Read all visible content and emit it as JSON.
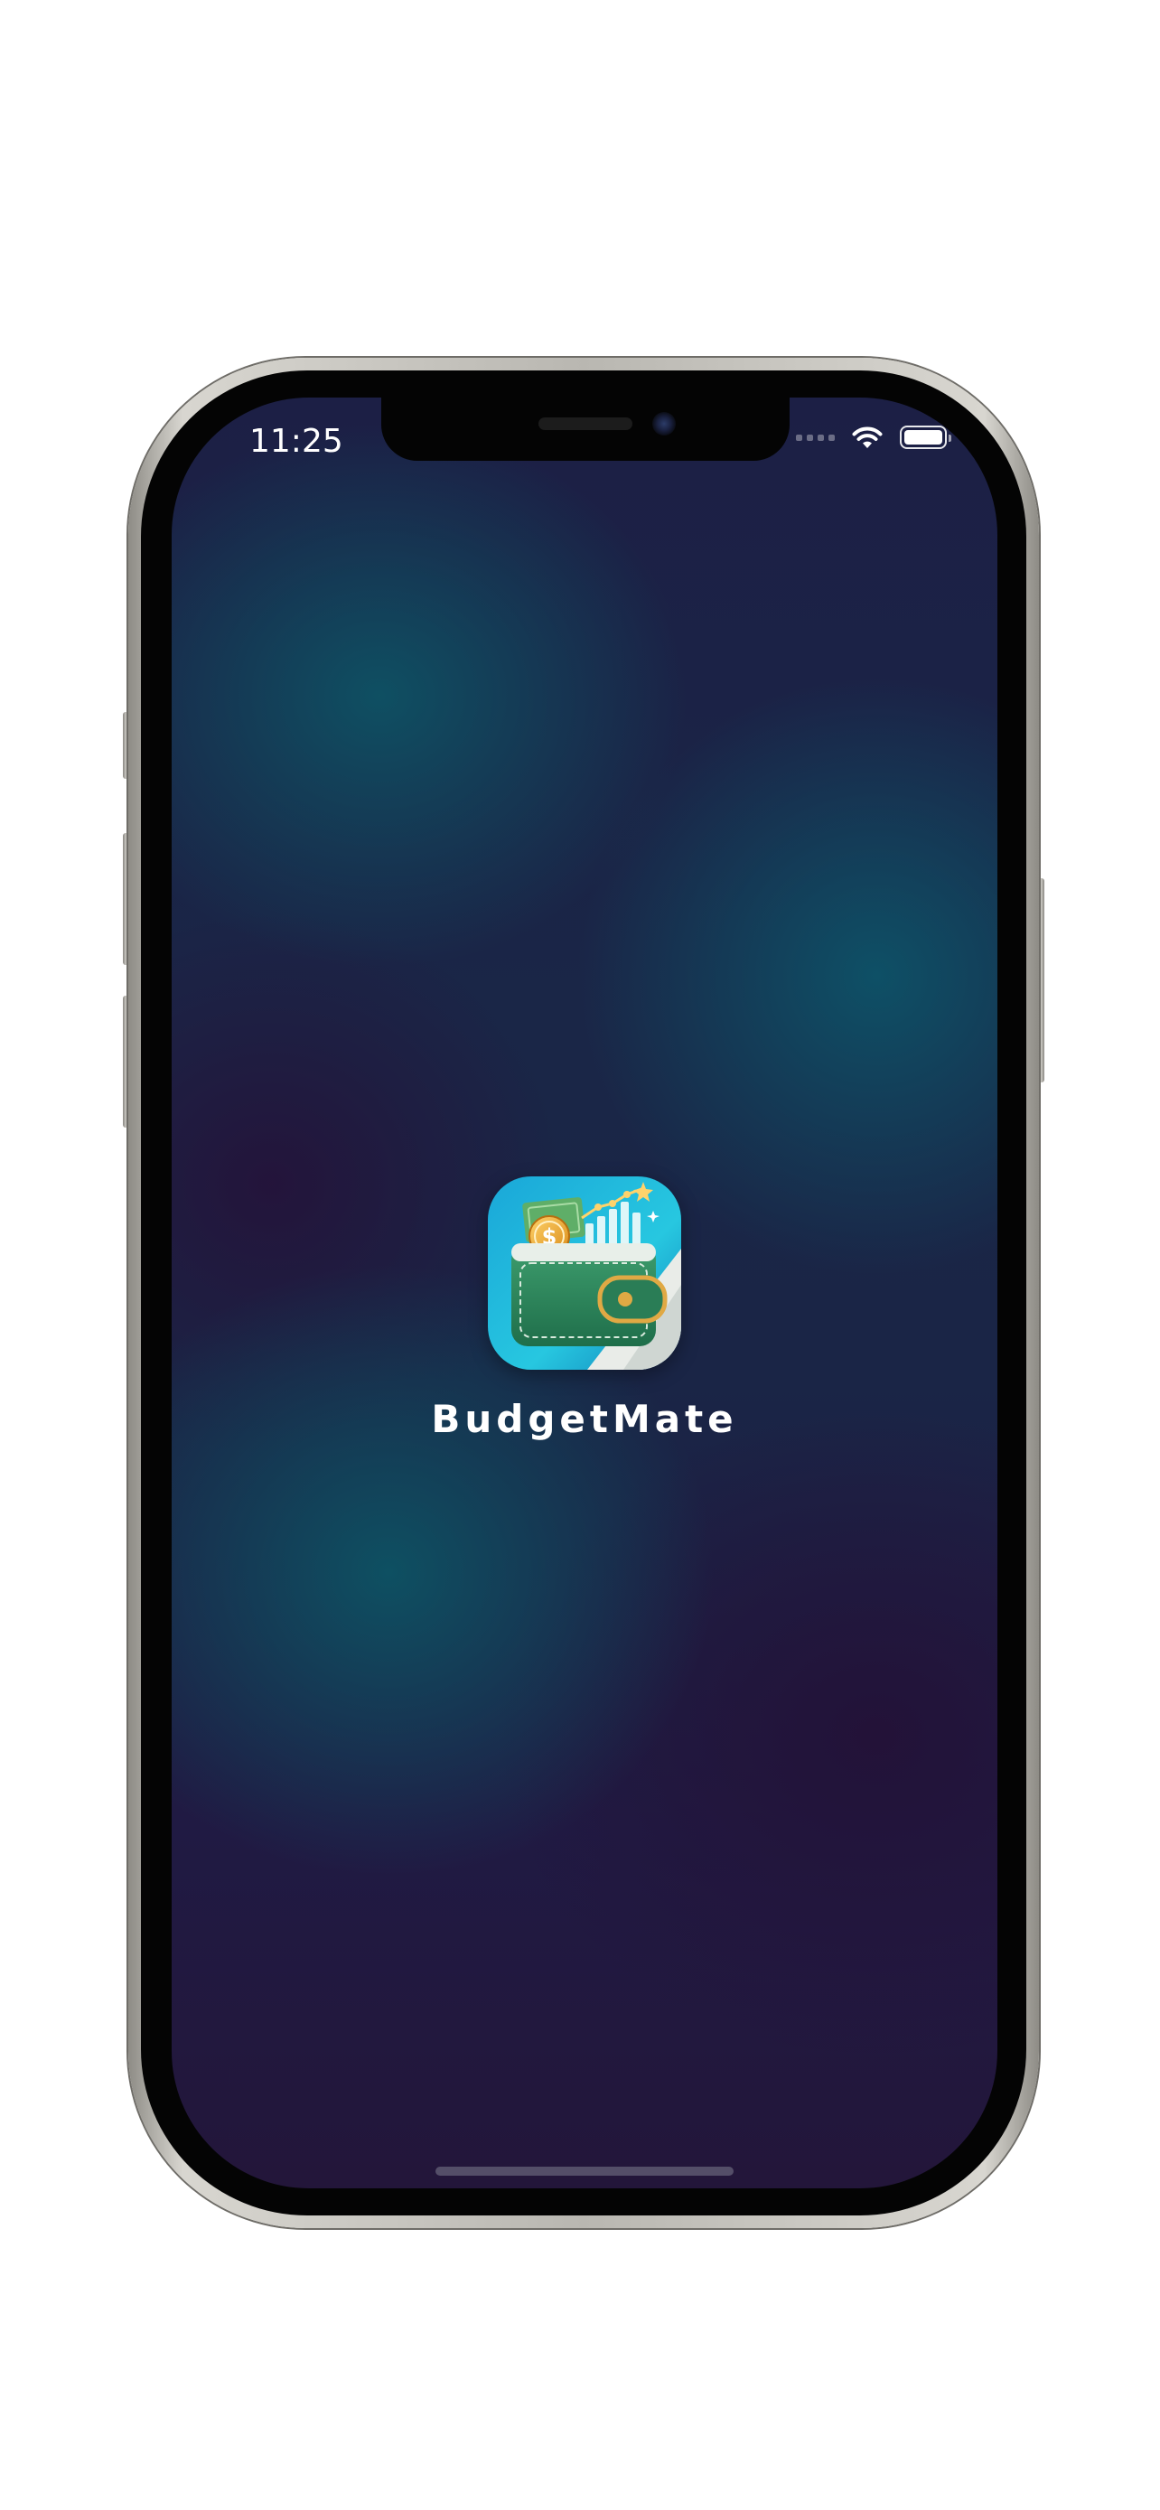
{
  "status_bar": {
    "time": "11:25",
    "signal_icon": "cellular-signal-icon",
    "wifi_icon": "wifi-icon",
    "battery_icon": "battery-icon",
    "battery_level": 1.0
  },
  "splash": {
    "app_icon": "wallet-app-icon",
    "app_name": "BudgetMate"
  },
  "colors": {
    "background_teal": "#0e5064",
    "background_purple": "#23163a",
    "background_navy": "#1c1f45",
    "text": "#ffffff"
  }
}
